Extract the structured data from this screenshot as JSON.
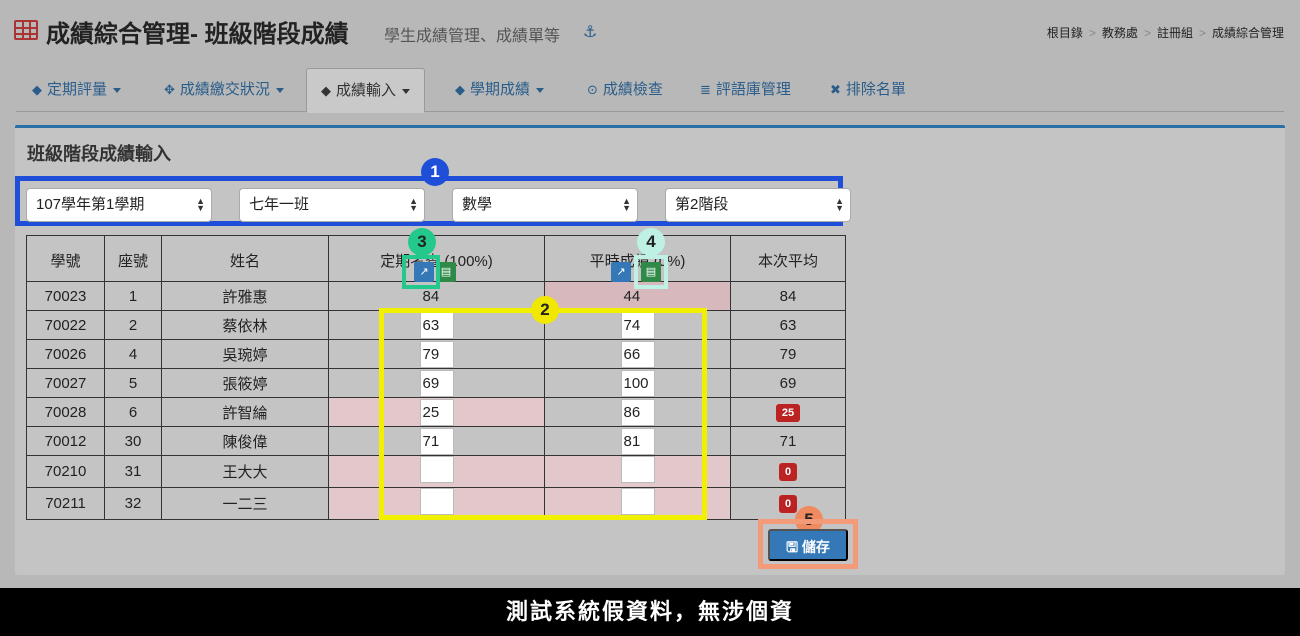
{
  "header": {
    "title": "成績綜合管理- 班級階段成績",
    "subtitle": "學生成績管理、成績單等",
    "breadcrumb": [
      "根目錄",
      "教務處",
      "註冊組",
      "成績綜合管理"
    ]
  },
  "tabs": [
    {
      "label": "定期評量",
      "icon": "tags-icon",
      "dropdown": true
    },
    {
      "label": "成績繳交狀況",
      "icon": "crosshair-icon",
      "dropdown": true
    },
    {
      "label": "成績輸入",
      "icon": "tags-icon",
      "dropdown": true,
      "active": true
    },
    {
      "label": "學期成績",
      "icon": "tags-icon",
      "dropdown": true
    },
    {
      "label": "成績檢查",
      "icon": "check-circle-icon",
      "dropdown": false
    },
    {
      "label": "評語庫管理",
      "icon": "database-icon",
      "dropdown": false
    },
    {
      "label": "排除名單",
      "icon": "user-times-icon",
      "dropdown": false
    }
  ],
  "panel": {
    "title": "班級階段成績輸入"
  },
  "filters": {
    "semester": "107學年第1學期",
    "class": "七年一班",
    "subject": "數學",
    "stage": "第2階段"
  },
  "table": {
    "headers": {
      "id": "學號",
      "seat": "座號",
      "name": "姓名",
      "exam": "定期考查 (100%)",
      "regular": "平時成績 (0%)",
      "average": "本次平均"
    },
    "rows": [
      {
        "id": "70023",
        "seat": "1",
        "name": "許雅惠",
        "exam": "84",
        "regular": "44",
        "average": "84"
      },
      {
        "id": "70022",
        "seat": "2",
        "name": "蔡依林",
        "exam": "63",
        "regular": "74",
        "average": "63"
      },
      {
        "id": "70026",
        "seat": "4",
        "name": "吳琬婷",
        "exam": "79",
        "regular": "66",
        "average": "79"
      },
      {
        "id": "70027",
        "seat": "5",
        "name": "張筱婷",
        "exam": "69",
        "regular": "100",
        "average": "69"
      },
      {
        "id": "70028",
        "seat": "6",
        "name": "許智綸",
        "exam": "25",
        "regular": "86",
        "average": "25"
      },
      {
        "id": "70012",
        "seat": "30",
        "name": "陳俊偉",
        "exam": "71",
        "regular": "81",
        "average": "71"
      },
      {
        "id": "70210",
        "seat": "31",
        "name": "王大大",
        "exam": "",
        "regular": "",
        "average": "0"
      },
      {
        "id": "70211",
        "seat": "32",
        "name": "一二三",
        "exam": "",
        "regular": "",
        "average": "0"
      }
    ]
  },
  "save_label": "儲存",
  "callouts": [
    "1",
    "2",
    "3",
    "4",
    "5"
  ],
  "footer": "測試系統假資料，無涉個資",
  "colors": {
    "callout1": "#1f4fd8",
    "callout2": "#f0e800",
    "callout3": "#22c98a",
    "callout4": "#bff0e4",
    "callout5": "#f08a60",
    "primary": "#3478b8",
    "danger": "#b22222"
  }
}
